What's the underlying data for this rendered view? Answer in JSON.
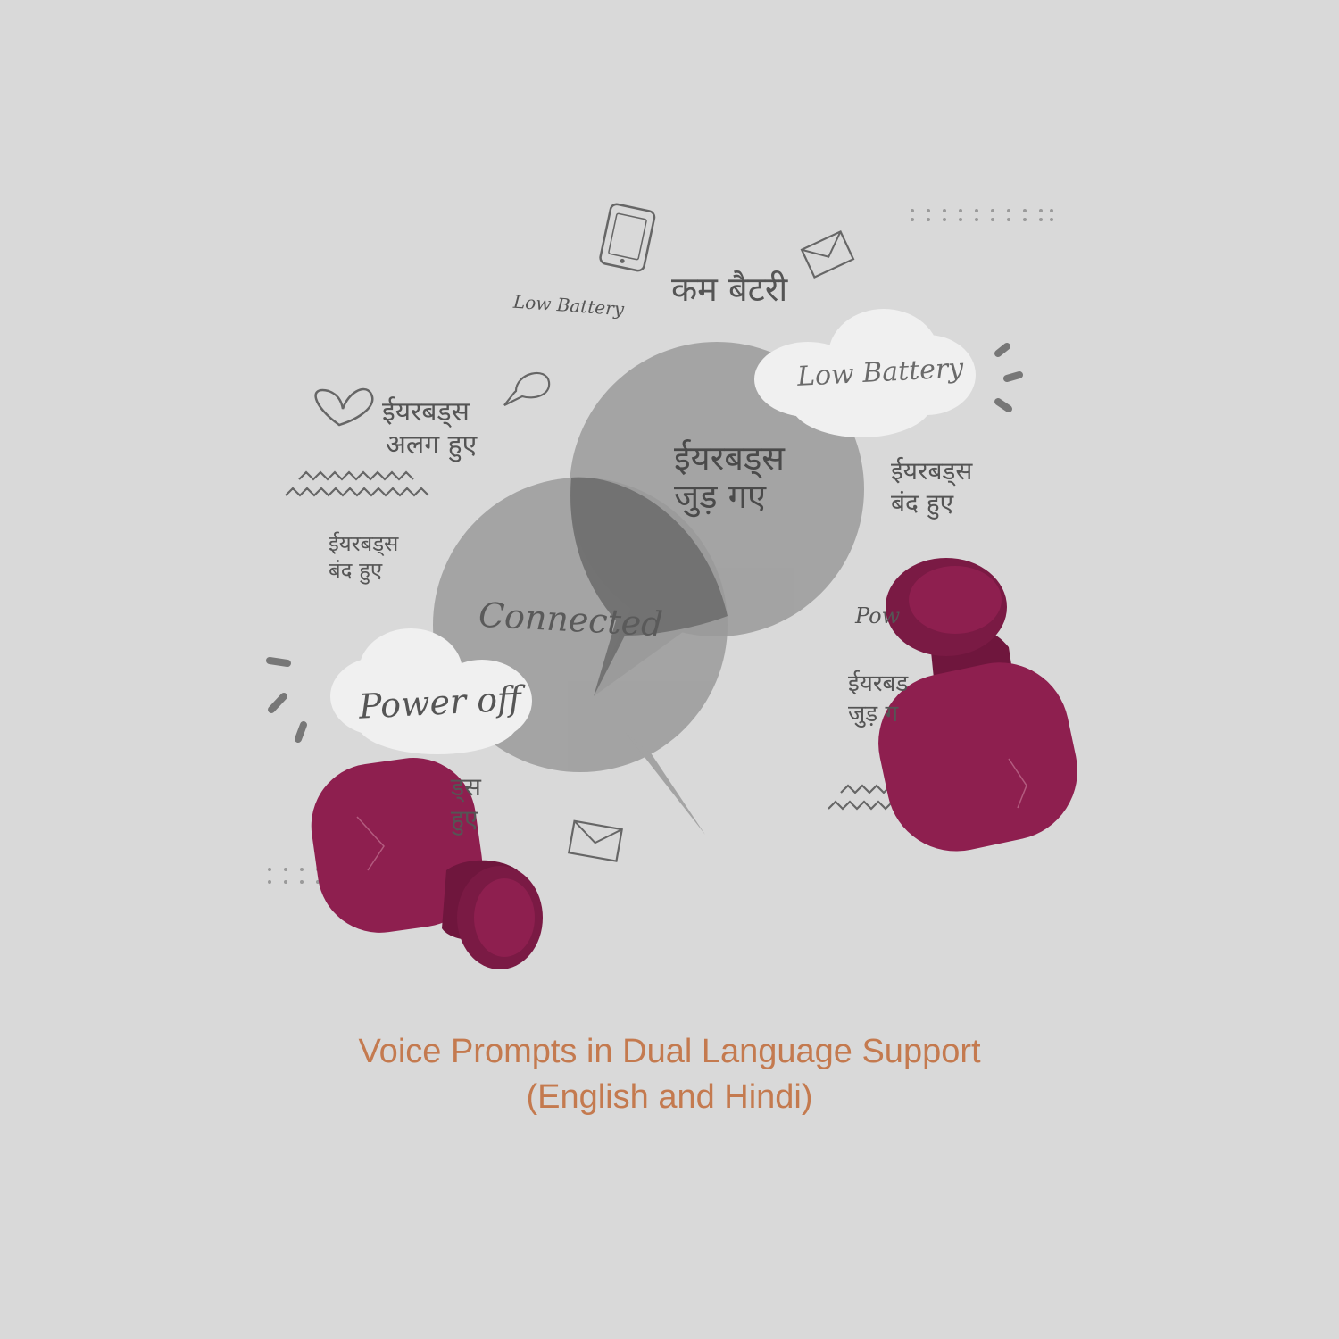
{
  "colors": {
    "background": "#d9d9d9",
    "caption": "#c47a4f",
    "earbud": "#8e1f4f",
    "bubble_light": "#9d9d9d",
    "bubble_dark": "#6c6c6c",
    "doodle": "#666666"
  },
  "icons": [
    "tablet-icon",
    "envelope-icon",
    "heart-icon",
    "speech-bubble-icon",
    "envelope-icon"
  ],
  "doodles": {
    "low_battery_small": "Low Battery",
    "kam_battery": "कम बैटरी",
    "earbuds_disconnected_line1": "ईयरबड्स",
    "earbuds_disconnected_line2": "अलग हुए",
    "earbuds_off_left_line1": "ईयरबड्स",
    "earbuds_off_left_line2": "बंद हुए",
    "earbuds_off_right_line1": "ईयरबड्स",
    "earbuds_off_right_line2": "बंद हुए",
    "earbuds_partial_bottom_line1": "ड्स",
    "earbuds_partial_bottom_line2": "हुए",
    "power_partial": "Pow",
    "earbuds_connected_right_line1": "ईयरबड",
    "earbuds_connected_right_line2": "जुड़ ग"
  },
  "bubbles": {
    "connected": "Connected",
    "hindi_connected_line1": "ईयरबड्स",
    "hindi_connected_line2": "जुड़ गए"
  },
  "clouds": {
    "low_battery": "Low Battery",
    "power_off": "Power off"
  },
  "caption": {
    "line1": "Voice Prompts in Dual Language Support",
    "line2": "(English and Hindi)"
  }
}
